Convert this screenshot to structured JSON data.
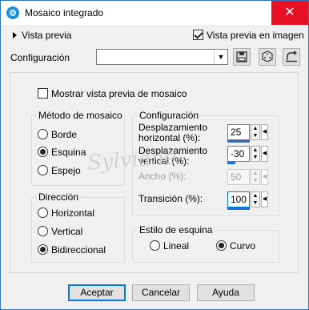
{
  "window": {
    "title": "Mosaico integrado",
    "close_glyph": "✕"
  },
  "preview": {
    "label": "Vista previa",
    "in_image_label": "Vista previa en imagen",
    "in_image_checked": true
  },
  "config": {
    "label": "Configuración",
    "value": ""
  },
  "show_tile_preview": {
    "label": "Mostrar vista previa de mosaico",
    "checked": false
  },
  "mosaic_method": {
    "title": "Método de mosaico",
    "options": [
      "Borde",
      "Esquina",
      "Espejo"
    ],
    "selected": "Esquina"
  },
  "configuration": {
    "title": "Configuración",
    "horizontal_offset": {
      "label_line1": "Desplazamiento",
      "label_line2": "horizontal (%):",
      "value": "25"
    },
    "vertical_offset": {
      "label_line1": "Desplazamiento",
      "label_line2": "vertical (%):",
      "value": "-30"
    },
    "width": {
      "label": "Ancho (%):",
      "value": "50",
      "disabled": true
    },
    "transition": {
      "label": "Transición (%):",
      "value": "100"
    }
  },
  "direction": {
    "title": "Dirección",
    "options": [
      "Horizontal",
      "Vertical",
      "Bidireccional"
    ],
    "selected": "Bidireccional"
  },
  "corner_style": {
    "title": "Estilo de esquina",
    "options": [
      "Lineal",
      "Curvo"
    ],
    "selected": "Curvo"
  },
  "buttons": {
    "ok": "Aceptar",
    "cancel": "Cancelar",
    "help": "Ayuda"
  },
  "watermark": "Sylviane"
}
